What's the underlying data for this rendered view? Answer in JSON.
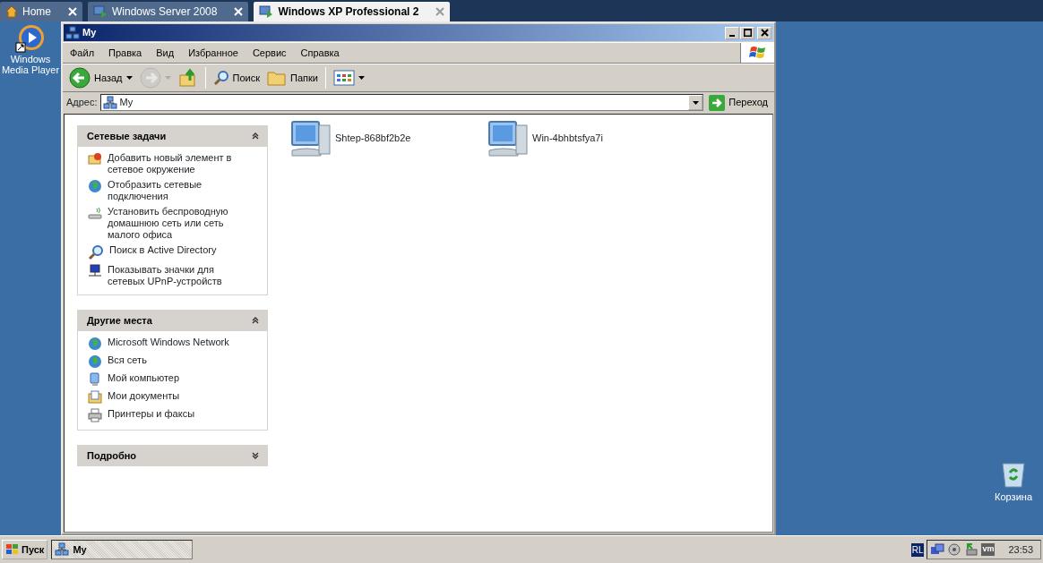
{
  "browser_tabs": [
    {
      "label": "Home",
      "selected": false
    },
    {
      "label": "Windows Server 2008",
      "selected": false
    },
    {
      "label": "Windows XP Professional 2",
      "selected": true
    }
  ],
  "desktop_left": {
    "label": "Windows Media Player"
  },
  "desktop_right": {
    "label": "Корзина"
  },
  "window": {
    "title": "My",
    "menu": [
      "Файл",
      "Правка",
      "Вид",
      "Избранное",
      "Сервис",
      "Справка"
    ],
    "toolbar": [
      {
        "kind": "back",
        "label": "Назад",
        "disabled": false
      },
      {
        "kind": "forward",
        "disabled": true
      },
      {
        "kind": "up",
        "disabled": false
      },
      {
        "kind": "search",
        "label": "Поиск",
        "disabled": false
      },
      {
        "kind": "folders",
        "label": "Папки",
        "disabled": false
      },
      {
        "kind": "views",
        "disabled": false
      }
    ],
    "address": {
      "label": "Адрес:",
      "value": "My",
      "go": "Переход"
    },
    "panels": [
      {
        "title": "Сетевые задачи",
        "expanded": true,
        "items": [
          "Добавить новый элемент в сетевое окружение",
          "Отобразить сетевые подключения",
          "Установить беспроводную домашнюю сеть или сеть малого офиса",
          "Поиск в Active Directory",
          "Показывать значки для сетевых UPnP-устройств"
        ]
      },
      {
        "title": "Другие места",
        "expanded": true,
        "items": [
          "Microsoft Windows Network",
          "Вся сеть",
          "Мой компьютер",
          "Мои документы",
          "Принтеры и факсы"
        ]
      },
      {
        "title": "Подробно",
        "expanded": false
      }
    ],
    "computers": [
      "Shtep-868bf2b2e",
      "Win-4bhbtsfya7i"
    ]
  },
  "taskbar": {
    "start": "Пуск",
    "tasks": [
      {
        "label": "My",
        "selected": true
      }
    ],
    "tray": {
      "language": "RL",
      "vm": "vm",
      "clock": "23:53"
    }
  }
}
